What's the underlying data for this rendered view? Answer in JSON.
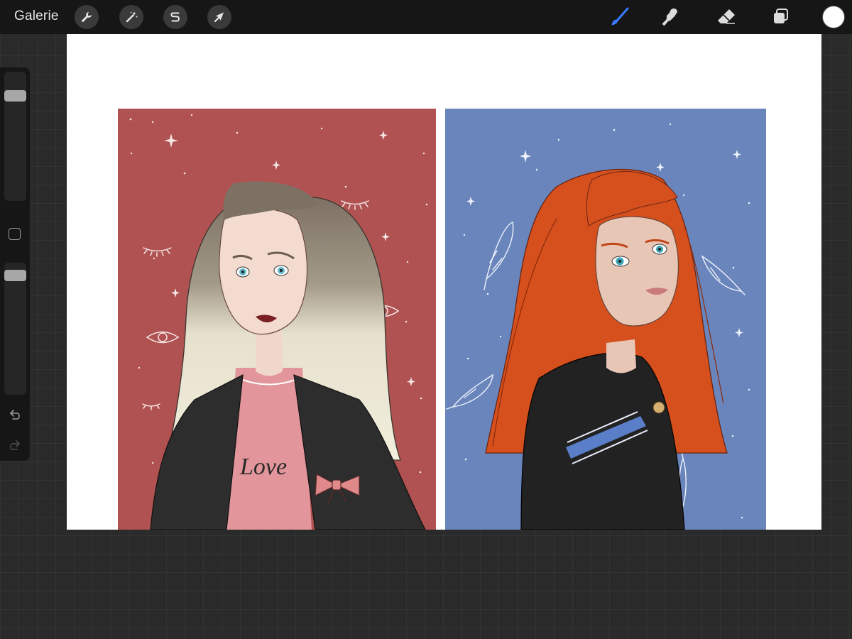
{
  "toolbar": {
    "gallery_label": "Galerie",
    "left_tools": [
      {
        "name": "actions",
        "icon": "wrench-icon"
      },
      {
        "name": "adjustments",
        "icon": "magic-wand-icon"
      },
      {
        "name": "selection",
        "icon": "selection-s-icon"
      },
      {
        "name": "transform",
        "icon": "arrow-cursor-icon"
      }
    ],
    "right_tools": [
      {
        "name": "brush",
        "icon": "brush-icon",
        "active": true
      },
      {
        "name": "smudge",
        "icon": "smudge-finger-icon",
        "active": false
      },
      {
        "name": "eraser",
        "icon": "eraser-icon",
        "active": false
      },
      {
        "name": "layers",
        "icon": "layers-icon",
        "active": false
      }
    ],
    "current_color": "#ffffff",
    "active_tool_color": "#3a7bff"
  },
  "sidebar": {
    "brush_size_level": 0.14,
    "opacity_level": 0.04,
    "modifier_icon": "square-modifier-icon",
    "undo_icon": "undo-arrow-icon",
    "redo_icon": "redo-arrow-icon"
  },
  "artwork": {
    "left_panel": {
      "background": "#b05251",
      "hair": "ombre-brown-to-blonde",
      "shirt_text": "Love",
      "shirt_color": "#e2959a",
      "jacket_color": "#2a2a2a",
      "bow_color": "#e0898b"
    },
    "right_panel": {
      "background": "#6985bb",
      "hair": "#d6501e",
      "shirt_color": "#222222",
      "sleeve_stripe": "#5a7ec8"
    }
  }
}
